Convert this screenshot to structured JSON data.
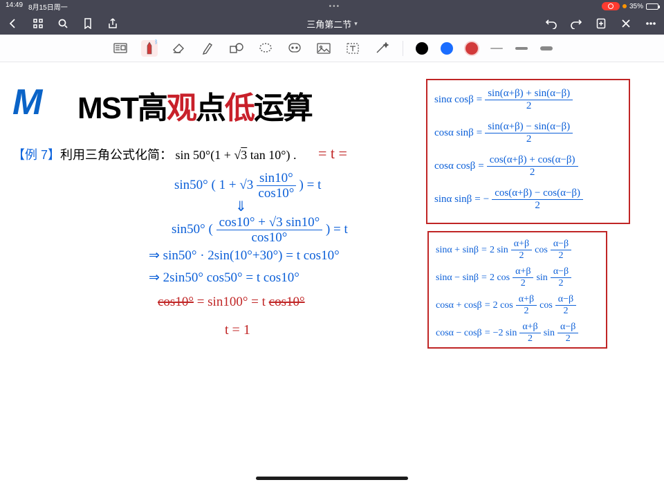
{
  "status": {
    "time": "14:49",
    "date": "8月15日周一",
    "ellipsis": "•••",
    "battery_pct": "35%"
  },
  "titlebar": {
    "title": "三角第二节"
  },
  "banner": {
    "text_black1": "MST高",
    "text_red1": "观",
    "text_black2": "点",
    "text_red2": "低",
    "text_black3": "运算"
  },
  "problem": {
    "tag": "【例 7】",
    "lead": "利用三角公式化简：",
    "math_a": "sin 50°(1 + ",
    "math_root": "3",
    "math_b": " tan 10°) ."
  },
  "work": {
    "l1_red": "= t =",
    "l2": {
      "a": "sin50° ( 1 + √3 ",
      "frac_n": "sin10°",
      "frac_d": "cos10°",
      "b": " ) = t"
    },
    "arrow": "⇓",
    "l3": {
      "a": "sin50° ( ",
      "frac_n": "cos10° + √3 sin10°",
      "frac_d": "cos10°",
      "b": " ) = t"
    },
    "l4": "⇒  sin50° · 2sin(10°+30°) = t cos10°",
    "l5": "⇒  2sin50° cos50° = t cos10°",
    "l6_a": "cos10°",
    "l6_b": " = sin100° = t ",
    "l6_c": "cos10°",
    "l7": "t = 1"
  },
  "box1": {
    "r1": {
      "lhs": "sinα cosβ",
      "num": "sin(α+β) + sin(α−β)",
      "den": "2"
    },
    "r2": {
      "lhs": "cosα sinβ",
      "num": "sin(α+β) − sin(α−β)",
      "den": "2"
    },
    "r3": {
      "lhs": "cosα cosβ",
      "num": "cos(α+β) + cos(α−β)",
      "den": "2"
    },
    "r4": {
      "lhs": "sinα sinβ",
      "pre": "−",
      "num": "cos(α+β) − cos(α−β)",
      "den": "2"
    }
  },
  "box2": {
    "r1": {
      "lhs": "sinα + sinβ",
      "rhs_a": "2 sin",
      "f1n": "α+β",
      "f1d": "2",
      "rhs_b": "cos",
      "f2n": "α−β",
      "f2d": "2"
    },
    "r2": {
      "lhs": "sinα − sinβ",
      "rhs_a": "2 cos",
      "f1n": "α+β",
      "f1d": "2",
      "rhs_b": "sin",
      "f2n": "α−β",
      "f2d": "2"
    },
    "r3": {
      "lhs": "cosα + cosβ",
      "rhs_a": "2 cos",
      "f1n": "α+β",
      "f1d": "2",
      "rhs_b": "cos",
      "f2n": "α−β",
      "f2d": "2"
    },
    "r4": {
      "lhs": "cosα − cosβ",
      "rhs_a": "−2 sin",
      "f1n": "α+β",
      "f1d": "2",
      "rhs_b": "sin",
      "f2n": "α−β",
      "f2d": "2"
    }
  }
}
